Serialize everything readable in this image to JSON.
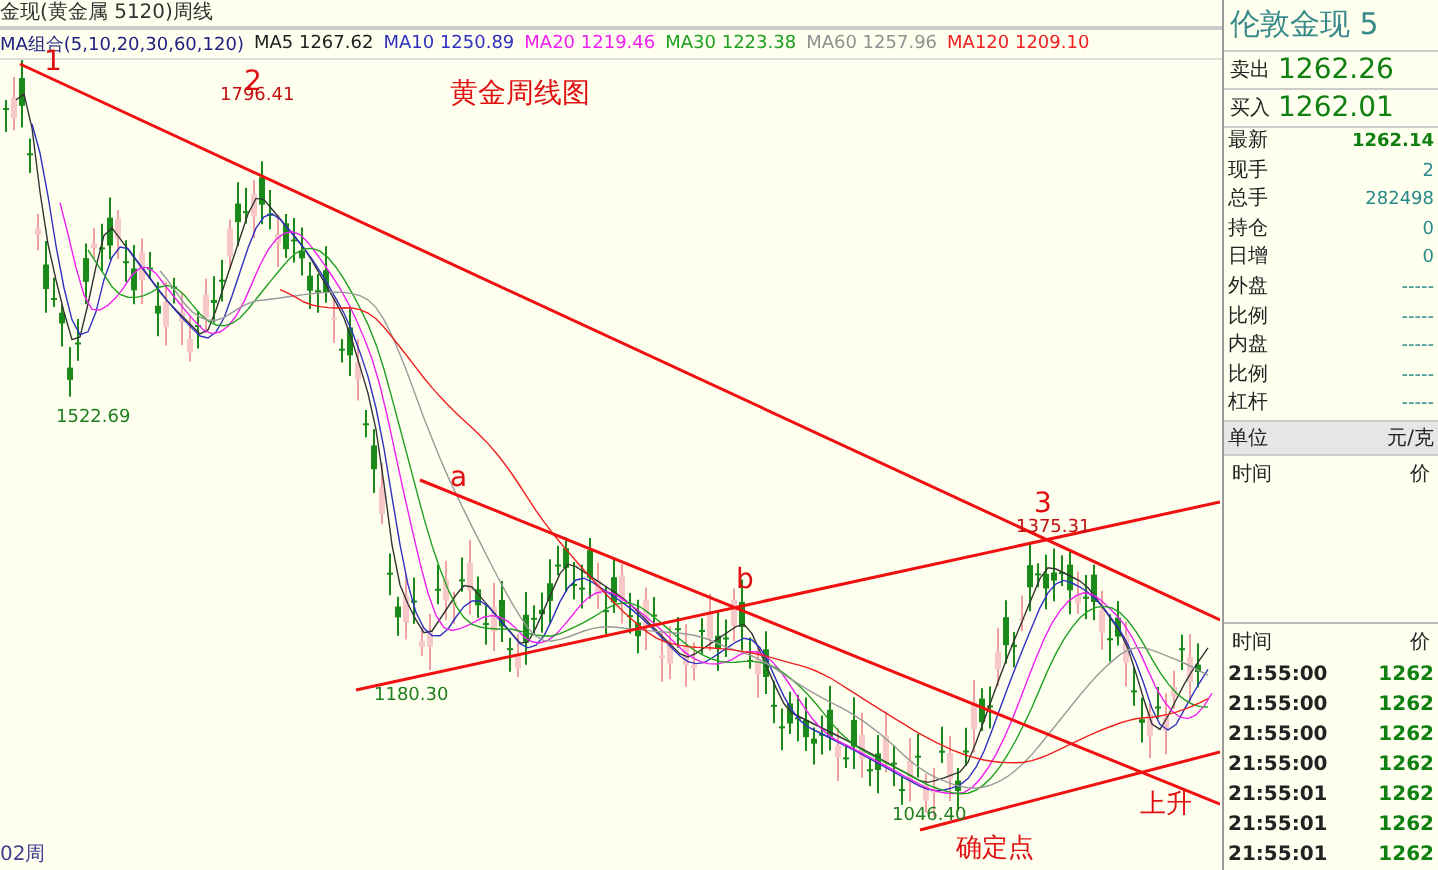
{
  "chart_title": "金现(黄金属 5120)周线",
  "ma_legend": [
    {
      "label": "MA组合(5,10,20,30,60,120)",
      "color": "#202080"
    },
    {
      "label": "MA5 1267.62",
      "color": "#202020"
    },
    {
      "label": "MA10 1250.89",
      "color": "#3030c0"
    },
    {
      "label": "MA20 1219.46",
      "color": "#f020f0"
    },
    {
      "label": "MA30 1223.38",
      "color": "#20a020"
    },
    {
      "label": "MA60 1257.96",
      "color": "#909090"
    },
    {
      "label": "MA120 1209.10",
      "color": "#f02020"
    }
  ],
  "chart_note": "黄金周线图",
  "wave_labels": [
    "1",
    "2",
    "3",
    "a",
    "b"
  ],
  "price_labels": [
    "1796.41",
    "1522.69",
    "1180.30",
    "1375.31",
    "1046.40"
  ],
  "notes": [
    "确定点",
    "上升"
  ],
  "period_label": "02周",
  "quote": {
    "name": "伦敦金现 5",
    "sell_label": "卖出",
    "sell": "1262.26",
    "buy_label": "买入",
    "buy": "1262.01"
  },
  "stats": [
    {
      "label": "最新",
      "value": "1262.14",
      "kind": "price"
    },
    {
      "label": "现手",
      "value": "2",
      "kind": "plain"
    },
    {
      "label": "总手",
      "value": "282498",
      "kind": "plain"
    },
    {
      "label": "持仓",
      "value": "0",
      "kind": "plain"
    },
    {
      "label": "日增",
      "value": "0",
      "kind": "plain"
    },
    {
      "label": "外盘",
      "value": "-----",
      "kind": "plain"
    },
    {
      "label": "比例",
      "value": "-----",
      "kind": "plain"
    },
    {
      "label": "内盘",
      "value": "-----",
      "kind": "plain"
    },
    {
      "label": "比例",
      "value": "-----",
      "kind": "plain"
    },
    {
      "label": "杠杆",
      "value": "-----",
      "kind": "plain"
    }
  ],
  "unit": {
    "label": "单位",
    "value": "元/克"
  },
  "time_header": {
    "time": "时间",
    "price": "价"
  },
  "ticks_header": {
    "time": "时间",
    "price": "价"
  },
  "ticks": [
    {
      "time": "21:55:00",
      "price": "1262"
    },
    {
      "time": "21:55:00",
      "price": "1262"
    },
    {
      "time": "21:55:00",
      "price": "1262"
    },
    {
      "time": "21:55:00",
      "price": "1262"
    },
    {
      "time": "21:55:01",
      "price": "1262"
    },
    {
      "time": "21:55:01",
      "price": "1262"
    },
    {
      "time": "21:55:01",
      "price": "1262"
    }
  ]
}
